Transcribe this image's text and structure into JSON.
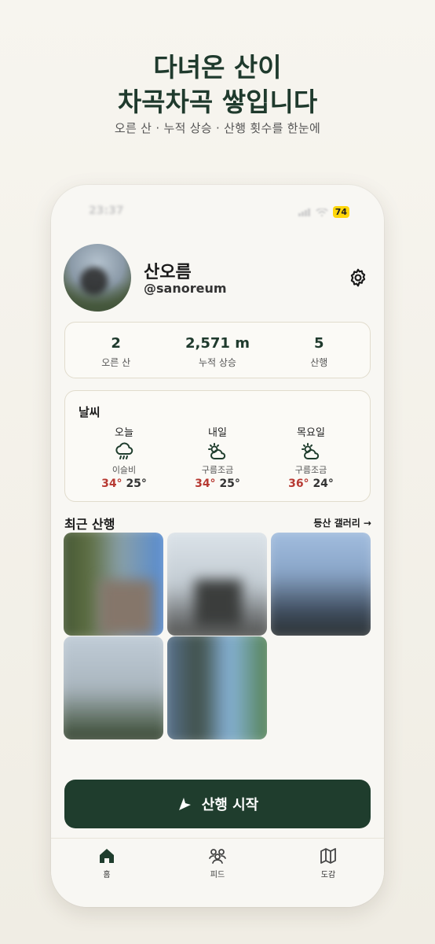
{
  "promo": {
    "headline_line1": "다녀온 산이",
    "headline_line2": "차곡차곡 쌓입니다",
    "subline": "오른 산 · 누적 상승 · 산행 횟수를 한눈에"
  },
  "status_bar": {
    "time": "23:37",
    "battery": "74"
  },
  "profile": {
    "name": "산오름",
    "handle": "@sanoreum"
  },
  "stats": [
    {
      "value": "2",
      "label": "오른 산"
    },
    {
      "value": "2,571 m",
      "label": "누적 상승"
    },
    {
      "value": "5",
      "label": "산행"
    }
  ],
  "weather": {
    "title": "날씨",
    "days": [
      {
        "name": "오늘",
        "icon": "rain-cloud-icon",
        "desc": "이슬비",
        "high": "34°",
        "low": "25°"
      },
      {
        "name": "내일",
        "icon": "partly-cloudy-icon",
        "desc": "구름조금",
        "high": "34°",
        "low": "25°"
      },
      {
        "name": "목요일",
        "icon": "partly-cloudy-icon",
        "desc": "구름조금",
        "high": "36°",
        "low": "24°"
      }
    ]
  },
  "recent": {
    "title": "최근 산행",
    "gallery_link": "등산 갤러리 →"
  },
  "start_button": {
    "label": "산행 시작"
  },
  "tabs": [
    {
      "label": "홈",
      "icon": "home-icon"
    },
    {
      "label": "피드",
      "icon": "people-icon"
    },
    {
      "label": "도감",
      "icon": "map-icon"
    }
  ],
  "colors": {
    "primary": "#1f3d2d",
    "high_temp": "#b73a33",
    "battery_badge": "#ffd60a"
  }
}
